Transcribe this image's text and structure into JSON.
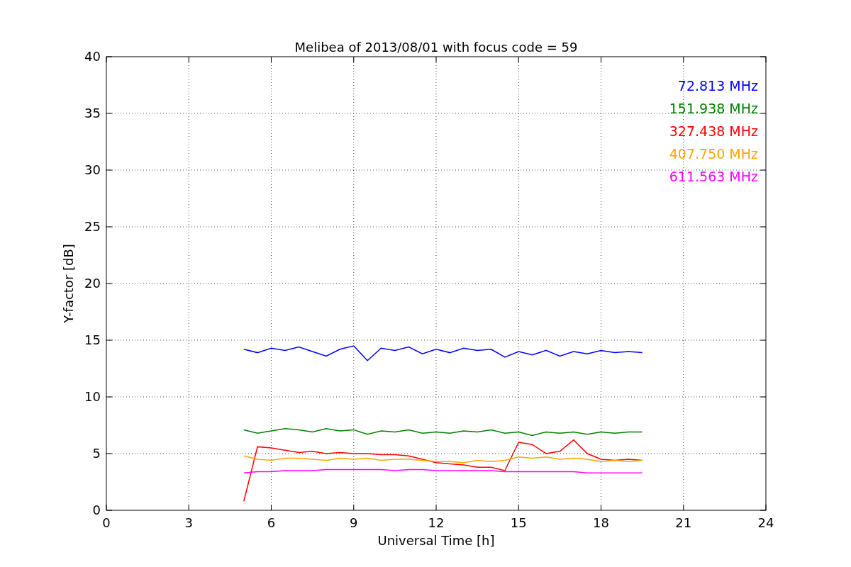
{
  "chart_data": {
    "type": "line",
    "title": "Melibea of 2013/08/01 with focus code = 59",
    "xlabel": "Universal Time [h]",
    "ylabel": "Y-factor [dB]",
    "x": [
      5,
      5.5,
      6,
      6.5,
      7,
      7.5,
      8,
      8.5,
      9,
      9.5,
      10,
      10.5,
      11,
      11.5,
      12,
      12.5,
      13,
      13.5,
      14,
      14.5,
      15,
      15.5,
      16,
      16.5,
      17,
      17.5,
      18,
      18.5,
      19,
      19.5
    ],
    "series": [
      {
        "name": "72.813 MHz",
        "color": "#0000ff",
        "values": [
          14.2,
          13.9,
          14.3,
          14.1,
          14.4,
          14.0,
          13.6,
          14.2,
          14.5,
          13.2,
          14.3,
          14.1,
          14.4,
          13.8,
          14.2,
          13.9,
          14.3,
          14.1,
          14.2,
          13.5,
          14.0,
          13.7,
          14.1,
          13.6,
          14.0,
          13.8,
          14.1,
          13.9,
          14.0,
          13.9
        ]
      },
      {
        "name": "151.938 MHz",
        "color": "#008000",
        "values": [
          7.1,
          6.8,
          7.0,
          7.2,
          7.1,
          6.9,
          7.2,
          7.0,
          7.1,
          6.7,
          7.0,
          6.9,
          7.1,
          6.8,
          6.9,
          6.8,
          7.0,
          6.9,
          7.1,
          6.8,
          6.9,
          6.6,
          6.9,
          6.8,
          6.9,
          6.7,
          6.9,
          6.8,
          6.9,
          6.9
        ]
      },
      {
        "name": "327.438 MHz",
        "color": "#ff0000",
        "values": [
          0.8,
          5.6,
          5.5,
          5.3,
          5.1,
          5.2,
          5.0,
          5.1,
          5.0,
          5.0,
          4.9,
          4.9,
          4.8,
          4.5,
          4.2,
          4.1,
          4.0,
          3.8,
          3.8,
          3.5,
          6.0,
          5.8,
          5.0,
          5.2,
          6.2,
          5.0,
          4.5,
          4.4,
          4.5,
          4.4
        ]
      },
      {
        "name": "407.750 MHz",
        "color": "#ffa500",
        "values": [
          4.8,
          4.5,
          4.4,
          4.6,
          4.6,
          4.5,
          4.4,
          4.6,
          4.5,
          4.6,
          4.4,
          4.5,
          4.5,
          4.4,
          4.3,
          4.3,
          4.2,
          4.4,
          4.3,
          4.4,
          4.7,
          4.6,
          4.7,
          4.5,
          4.6,
          4.5,
          4.3,
          4.4,
          4.3,
          4.4
        ]
      },
      {
        "name": "611.563 MHz",
        "color": "#ff00ff",
        "values": [
          3.3,
          3.4,
          3.4,
          3.5,
          3.5,
          3.5,
          3.6,
          3.6,
          3.6,
          3.6,
          3.6,
          3.5,
          3.6,
          3.6,
          3.5,
          3.5,
          3.5,
          3.5,
          3.5,
          3.4,
          3.4,
          3.4,
          3.4,
          3.4,
          3.4,
          3.3,
          3.3,
          3.3,
          3.3,
          3.3
        ]
      }
    ],
    "grid": true,
    "xlim": [
      0,
      24
    ],
    "ylim": [
      0,
      40
    ],
    "xticks": [
      0,
      3,
      6,
      9,
      12,
      15,
      18,
      21,
      24
    ],
    "yticks": [
      0,
      5,
      10,
      15,
      20,
      25,
      30,
      35,
      40
    ]
  }
}
